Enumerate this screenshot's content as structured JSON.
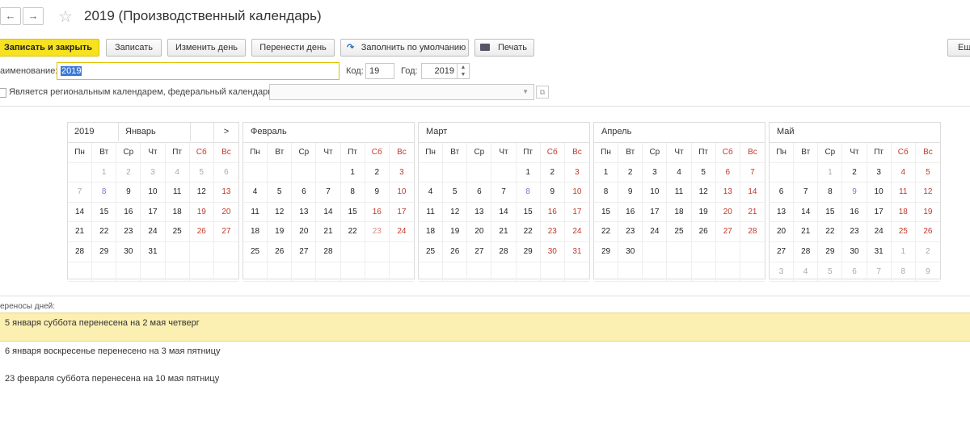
{
  "window": {
    "title": "2019 (Производственный календарь)"
  },
  "nav": {
    "back": "←",
    "forward": "→",
    "star": "☆"
  },
  "toolbar": {
    "save_close": "Записать и закрыть",
    "save": "Записать",
    "change_day": "Изменить день",
    "move_day": "Перенести день",
    "fill_default": "Заполнить по умолчанию",
    "print": "Печать",
    "more": "Ещ"
  },
  "form": {
    "name_label": "аименование:",
    "name_value": "2019",
    "code_label": "Код:",
    "code_value": "19",
    "year_label": "Год:",
    "year_value": "2019",
    "regional_label": "Является региональным календарем, федеральный календарь",
    "federal_value": ""
  },
  "calendar": {
    "year": "2019",
    "nav_next": ">",
    "weekdays": [
      "Пн",
      "Вт",
      "Ср",
      "Чт",
      "Пт",
      "Сб",
      "Вс"
    ],
    "months": [
      {
        "name": "Январь",
        "cells": [
          [
            "",
            ""
          ],
          [
            "1",
            "dim"
          ],
          [
            "2",
            "dim"
          ],
          [
            "3",
            "dim"
          ],
          [
            "4",
            "dim"
          ],
          [
            "5",
            "dim"
          ],
          [
            "6",
            "dim"
          ],
          [
            "7",
            "dim"
          ],
          [
            "8",
            "blue"
          ],
          [
            "9",
            ""
          ],
          [
            "10",
            ""
          ],
          [
            "11",
            ""
          ],
          [
            "12",
            ""
          ],
          [
            "13",
            "red"
          ],
          [
            "14",
            ""
          ],
          [
            "15",
            ""
          ],
          [
            "16",
            ""
          ],
          [
            "17",
            ""
          ],
          [
            "18",
            ""
          ],
          [
            "19",
            "red"
          ],
          [
            "20",
            "red"
          ],
          [
            "21",
            ""
          ],
          [
            "22",
            ""
          ],
          [
            "23",
            ""
          ],
          [
            "24",
            ""
          ],
          [
            "25",
            ""
          ],
          [
            "26",
            "red"
          ],
          [
            "27",
            "red"
          ],
          [
            "28",
            ""
          ],
          [
            "29",
            ""
          ],
          [
            "30",
            ""
          ],
          [
            "31",
            ""
          ],
          [
            "",
            ""
          ],
          [
            "",
            ""
          ],
          [
            "",
            ""
          ],
          [
            "",
            ""
          ],
          [
            "",
            ""
          ],
          [
            "",
            ""
          ],
          [
            "",
            ""
          ],
          [
            "",
            ""
          ],
          [
            "",
            ""
          ],
          [
            "",
            ""
          ]
        ]
      },
      {
        "name": "Февраль",
        "cells": [
          [
            "",
            ""
          ],
          [
            "",
            ""
          ],
          [
            "",
            ""
          ],
          [
            "",
            ""
          ],
          [
            "1",
            ""
          ],
          [
            "2",
            ""
          ],
          [
            "3",
            "red"
          ],
          [
            "4",
            ""
          ],
          [
            "5",
            ""
          ],
          [
            "6",
            ""
          ],
          [
            "7",
            ""
          ],
          [
            "8",
            ""
          ],
          [
            "9",
            ""
          ],
          [
            "10",
            "red"
          ],
          [
            "11",
            ""
          ],
          [
            "12",
            ""
          ],
          [
            "13",
            ""
          ],
          [
            "14",
            ""
          ],
          [
            "15",
            ""
          ],
          [
            "16",
            "red"
          ],
          [
            "17",
            "red"
          ],
          [
            "18",
            ""
          ],
          [
            "19",
            ""
          ],
          [
            "20",
            ""
          ],
          [
            "21",
            ""
          ],
          [
            "22",
            ""
          ],
          [
            "23",
            "redlt"
          ],
          [
            "24",
            "red"
          ],
          [
            "25",
            ""
          ],
          [
            "26",
            ""
          ],
          [
            "27",
            ""
          ],
          [
            "28",
            ""
          ],
          [
            "",
            ""
          ],
          [
            "",
            ""
          ],
          [
            "",
            ""
          ],
          [
            "",
            ""
          ],
          [
            "",
            ""
          ],
          [
            "",
            ""
          ],
          [
            "",
            ""
          ],
          [
            "",
            ""
          ],
          [
            "",
            ""
          ],
          [
            "",
            ""
          ]
        ]
      },
      {
        "name": "Март",
        "cells": [
          [
            "",
            ""
          ],
          [
            "",
            ""
          ],
          [
            "",
            ""
          ],
          [
            "",
            ""
          ],
          [
            "1",
            ""
          ],
          [
            "2",
            ""
          ],
          [
            "3",
            "red"
          ],
          [
            "4",
            ""
          ],
          [
            "5",
            ""
          ],
          [
            "6",
            ""
          ],
          [
            "7",
            ""
          ],
          [
            "8",
            "blue"
          ],
          [
            "9",
            ""
          ],
          [
            "10",
            "red"
          ],
          [
            "11",
            ""
          ],
          [
            "12",
            ""
          ],
          [
            "13",
            ""
          ],
          [
            "14",
            ""
          ],
          [
            "15",
            ""
          ],
          [
            "16",
            "red"
          ],
          [
            "17",
            "red"
          ],
          [
            "18",
            ""
          ],
          [
            "19",
            ""
          ],
          [
            "20",
            ""
          ],
          [
            "21",
            ""
          ],
          [
            "22",
            ""
          ],
          [
            "23",
            "red"
          ],
          [
            "24",
            "red"
          ],
          [
            "25",
            ""
          ],
          [
            "26",
            ""
          ],
          [
            "27",
            ""
          ],
          [
            "28",
            ""
          ],
          [
            "29",
            ""
          ],
          [
            "30",
            "red"
          ],
          [
            "31",
            "red"
          ],
          [
            "",
            ""
          ],
          [
            "",
            ""
          ],
          [
            "",
            ""
          ],
          [
            "",
            ""
          ],
          [
            "",
            ""
          ],
          [
            "",
            ""
          ],
          [
            "",
            ""
          ]
        ]
      },
      {
        "name": "Апрель",
        "cells": [
          [
            "1",
            ""
          ],
          [
            "2",
            ""
          ],
          [
            "3",
            ""
          ],
          [
            "4",
            ""
          ],
          [
            "5",
            ""
          ],
          [
            "6",
            "red"
          ],
          [
            "7",
            "red"
          ],
          [
            "8",
            ""
          ],
          [
            "9",
            ""
          ],
          [
            "10",
            ""
          ],
          [
            "11",
            ""
          ],
          [
            "12",
            ""
          ],
          [
            "13",
            "red"
          ],
          [
            "14",
            "red"
          ],
          [
            "15",
            ""
          ],
          [
            "16",
            ""
          ],
          [
            "17",
            ""
          ],
          [
            "18",
            ""
          ],
          [
            "19",
            ""
          ],
          [
            "20",
            "red"
          ],
          [
            "21",
            "red"
          ],
          [
            "22",
            ""
          ],
          [
            "23",
            ""
          ],
          [
            "24",
            ""
          ],
          [
            "25",
            ""
          ],
          [
            "26",
            ""
          ],
          [
            "27",
            "red"
          ],
          [
            "28",
            "red"
          ],
          [
            "29",
            ""
          ],
          [
            "30",
            ""
          ],
          [
            "",
            ""
          ],
          [
            "",
            ""
          ],
          [
            "",
            ""
          ],
          [
            "",
            ""
          ],
          [
            "",
            ""
          ],
          [
            "",
            ""
          ],
          [
            "",
            ""
          ],
          [
            "",
            ""
          ],
          [
            "",
            ""
          ],
          [
            "",
            ""
          ],
          [
            "",
            ""
          ],
          [
            "",
            ""
          ]
        ]
      },
      {
        "name": "Май",
        "cells": [
          [
            "",
            ""
          ],
          [
            "",
            ""
          ],
          [
            "1",
            "dim"
          ],
          [
            "2",
            ""
          ],
          [
            "3",
            ""
          ],
          [
            "4",
            "red"
          ],
          [
            "5",
            "red"
          ],
          [
            "6",
            ""
          ],
          [
            "7",
            ""
          ],
          [
            "8",
            ""
          ],
          [
            "9",
            "blue"
          ],
          [
            "10",
            ""
          ],
          [
            "11",
            "red"
          ],
          [
            "12",
            "red"
          ],
          [
            "13",
            ""
          ],
          [
            "14",
            ""
          ],
          [
            "15",
            ""
          ],
          [
            "16",
            ""
          ],
          [
            "17",
            ""
          ],
          [
            "18",
            "red"
          ],
          [
            "19",
            "red"
          ],
          [
            "20",
            ""
          ],
          [
            "21",
            ""
          ],
          [
            "22",
            ""
          ],
          [
            "23",
            ""
          ],
          [
            "24",
            ""
          ],
          [
            "25",
            "red"
          ],
          [
            "26",
            "red"
          ],
          [
            "27",
            ""
          ],
          [
            "28",
            ""
          ],
          [
            "29",
            ""
          ],
          [
            "30",
            ""
          ],
          [
            "31",
            ""
          ],
          [
            "1",
            "dim"
          ],
          [
            "2",
            "dim"
          ],
          [
            "3",
            "dim"
          ],
          [
            "4",
            "dim"
          ],
          [
            "5",
            "dim"
          ],
          [
            "6",
            "dim"
          ],
          [
            "7",
            "dim"
          ],
          [
            "8",
            "dim"
          ],
          [
            "9",
            "dim"
          ]
        ]
      }
    ]
  },
  "transfers": {
    "title": "ереносы дней:",
    "items": [
      "5 января суббота перенесена на 2 мая четверг",
      "6 января воскресенье перенесено на 3 мая пятницу",
      "23 февраля суббота перенесена на 10 мая пятницу"
    ]
  }
}
